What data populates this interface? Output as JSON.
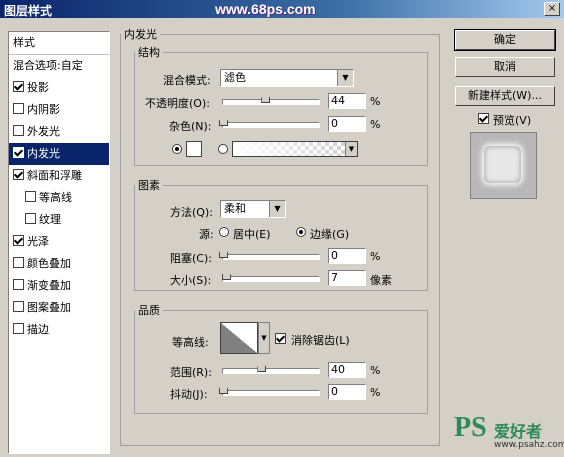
{
  "window": {
    "title": "图层样式",
    "watermark_top": "www.68ps.com",
    "close": "×"
  },
  "sidebar": {
    "header": "样式",
    "blend_options": "混合选项:自定",
    "items": [
      {
        "label": "投影",
        "checked": true,
        "indent": false,
        "selected": false
      },
      {
        "label": "内阴影",
        "checked": false,
        "indent": false,
        "selected": false
      },
      {
        "label": "外发光",
        "checked": false,
        "indent": false,
        "selected": false
      },
      {
        "label": "内发光",
        "checked": true,
        "indent": false,
        "selected": true
      },
      {
        "label": "斜面和浮雕",
        "checked": true,
        "indent": false,
        "selected": false
      },
      {
        "label": "等高线",
        "checked": false,
        "indent": true,
        "selected": false
      },
      {
        "label": "纹理",
        "checked": false,
        "indent": true,
        "selected": false
      },
      {
        "label": "光泽",
        "checked": true,
        "indent": false,
        "selected": false
      },
      {
        "label": "颜色叠加",
        "checked": false,
        "indent": false,
        "selected": false
      },
      {
        "label": "渐变叠加",
        "checked": false,
        "indent": false,
        "selected": false
      },
      {
        "label": "图案叠加",
        "checked": false,
        "indent": false,
        "selected": false
      },
      {
        "label": "描边",
        "checked": false,
        "indent": false,
        "selected": false
      }
    ]
  },
  "panel": {
    "title": "内发光",
    "structure": {
      "legend": "结构",
      "blend_mode_label": "混合模式:",
      "blend_mode_value": "滤色",
      "opacity_label": "不透明度(O):",
      "opacity_value": "44",
      "opacity_fraction": 0.44,
      "noise_label": "杂色(N):",
      "noise_value": "0",
      "noise_fraction": 0.0,
      "percent": "%"
    },
    "elements": {
      "legend": "图素",
      "technique_label": "方法(Q):",
      "technique_value": "柔和",
      "source_label": "源:",
      "source_center": "居中(E)",
      "source_edge": "边缘(G)",
      "choke_label": "阻塞(C):",
      "choke_value": "0",
      "choke_fraction": 0.0,
      "size_label": "大小(S):",
      "size_value": "7",
      "size_fraction": 0.03,
      "size_unit": "像素",
      "percent": "%"
    },
    "quality": {
      "legend": "品质",
      "contour_label": "等高线:",
      "antialias_label": "消除锯齿(L)",
      "antialias_checked": true,
      "range_label": "范围(R):",
      "range_value": "40",
      "range_fraction": 0.4,
      "jitter_label": "抖动(J):",
      "jitter_value": "0",
      "jitter_fraction": 0.0,
      "percent": "%"
    }
  },
  "buttons": {
    "ok": "确定",
    "cancel": "取消",
    "new_style": "新建样式(W)...",
    "preview": "预览(V)",
    "preview_checked": true
  },
  "watermark_bottom": {
    "logo": "PS",
    "cn": "爱好者",
    "url": "www.psahz.com"
  }
}
